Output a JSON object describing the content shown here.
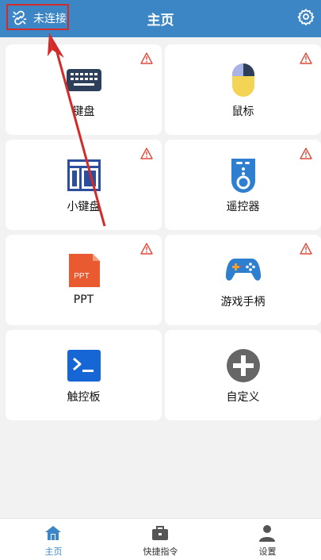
{
  "header": {
    "title": "主页",
    "connection_status": "未连接"
  },
  "cards": [
    {
      "label": "键盘",
      "icon": "keyboard-icon",
      "warning": true
    },
    {
      "label": "鼠标",
      "icon": "mouse-icon",
      "warning": true
    },
    {
      "label": "小键盘",
      "icon": "numpad-icon",
      "warning": true
    },
    {
      "label": "遥控器",
      "icon": "remote-control-icon",
      "warning": true
    },
    {
      "label": "PPT",
      "icon": "ppt-icon",
      "icon_text": "PPT",
      "warning": true
    },
    {
      "label": "游戏手柄",
      "icon": "gamepad-icon",
      "warning": true
    },
    {
      "label": "触控板",
      "icon": "terminal-touchpad-icon",
      "warning": false
    },
    {
      "label": "自定义",
      "icon": "add-custom-icon",
      "warning": false
    }
  ],
  "tabs": [
    {
      "label": "主页",
      "icon": "home-icon",
      "active": true
    },
    {
      "label": "快捷指令",
      "icon": "briefcase-icon",
      "active": false
    },
    {
      "label": "设置",
      "icon": "person-icon",
      "active": false
    }
  ],
  "colors": {
    "header": "#3d86c6",
    "accent": "#3d86c6",
    "warning": "#e04a3a",
    "annotation": "#d32a2a"
  }
}
